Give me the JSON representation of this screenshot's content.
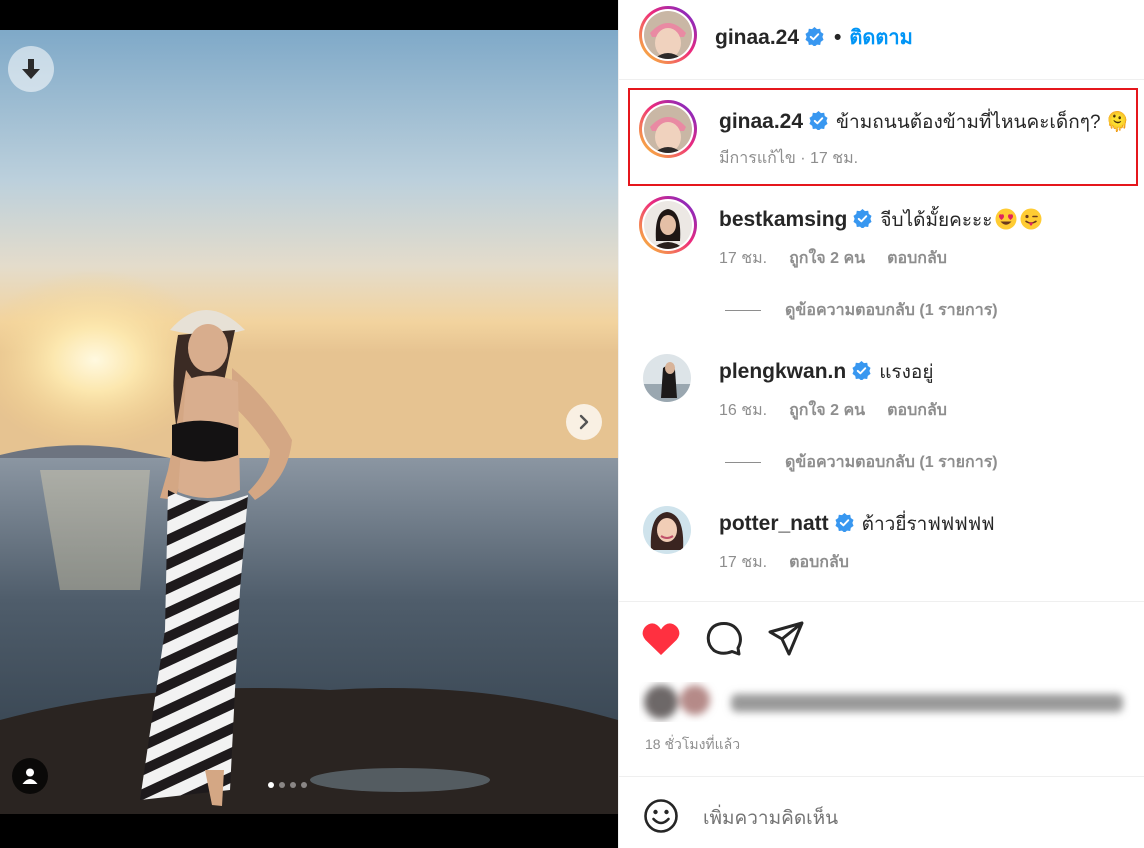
{
  "post": {
    "author": "ginaa.24",
    "follow_separator": "•",
    "follow_label": "ติดตาม"
  },
  "caption": {
    "username": "ginaa.24",
    "text": "ข้ามถนนต้องข้ามที่ไหนคะเด็กๆ? 🫠",
    "meta_edited": "มีการแก้ไข · 17 ชม."
  },
  "comments": [
    {
      "username": "bestkamsing",
      "text": "จีบได้มั้ยคะะะ",
      "emojis": [
        "heart-eyes-emoji",
        "tongue-wink-emoji"
      ],
      "time": "17 ชม.",
      "likes": "ถูกใจ 2 คน",
      "reply": "ตอบกลับ",
      "view_replies": "ดูข้อความตอบกลับ (1 รายการ)"
    },
    {
      "username": "plengkwan.n",
      "text": "แรงอยู่",
      "time": "16 ชม.",
      "likes": "ถูกใจ 2 คน",
      "reply": "ตอบกลับ",
      "view_replies": "ดูข้อความตอบกลับ (1 รายการ)"
    },
    {
      "username": "potter_natt",
      "text": "ต้าวยี่ราฟฟฟฟฟ",
      "time": "17 ชม.",
      "reply": "ตอบกลับ"
    }
  ],
  "actions": {
    "liked": true,
    "like_color": "#ff3040",
    "icons": [
      "heart-icon",
      "comment-icon",
      "share-icon"
    ]
  },
  "post_time": "18 ชั่วโมงที่แล้ว",
  "comment_input": {
    "placeholder": "เพิ่มความคิดเห็น"
  },
  "carousel": {
    "current_slide": 1,
    "slide_count": 4
  },
  "colors": {
    "accent": "#0095f6",
    "highlight_box": "#e5161c",
    "muted_text": "#8e8e8e"
  }
}
